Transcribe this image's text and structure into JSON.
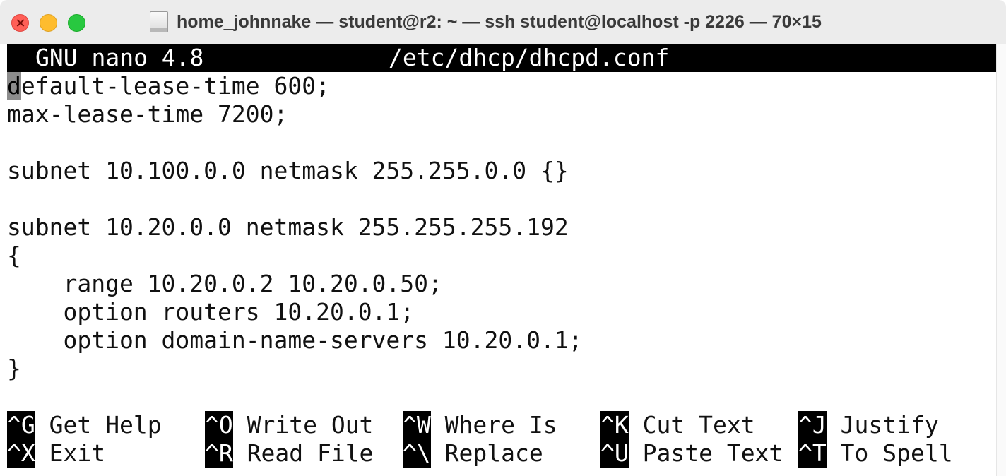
{
  "window": {
    "title": "home_johnnake — student@r2: ~ — ssh student@localhost -p 2226 — 70×15"
  },
  "nano": {
    "app": "GNU nano 4.8",
    "filename": "/etc/dhcp/dhcpd.conf",
    "cursor_char": "d",
    "lines": [
      "efault-lease-time 600;",
      "max-lease-time 7200;",
      "",
      "subnet 10.100.0.0 netmask 255.255.0.0 {}",
      "",
      "subnet 10.20.0.0 netmask 255.255.255.192",
      "{",
      "    range 10.20.0.2 10.20.0.50;",
      "    option routers 10.20.0.1;",
      "    option domain-name-servers 10.20.0.1;",
      "}"
    ],
    "shortcuts": {
      "row1": [
        {
          "key": "^G",
          "label": " Get Help"
        },
        {
          "key": "^O",
          "label": " Write Out"
        },
        {
          "key": "^W",
          "label": " Where Is"
        },
        {
          "key": "^K",
          "label": " Cut Text"
        },
        {
          "key": "^J",
          "label": " Justify"
        }
      ],
      "row2": [
        {
          "key": "^X",
          "label": " Exit"
        },
        {
          "key": "^R",
          "label": " Read File"
        },
        {
          "key": "^\\",
          "label": " Replace"
        },
        {
          "key": "^U",
          "label": " Paste Text"
        },
        {
          "key": "^T",
          "label": " To Spell"
        }
      ]
    }
  },
  "colors": {
    "close": "#ff5f57",
    "minimize": "#febc2e",
    "zoom": "#28c840",
    "header_bg": "#000000",
    "cursor": "#8c8c8c"
  },
  "icons": {
    "close": "close-icon",
    "minimize": "minimize-icon",
    "zoom": "zoom-icon",
    "document": "document-icon"
  }
}
